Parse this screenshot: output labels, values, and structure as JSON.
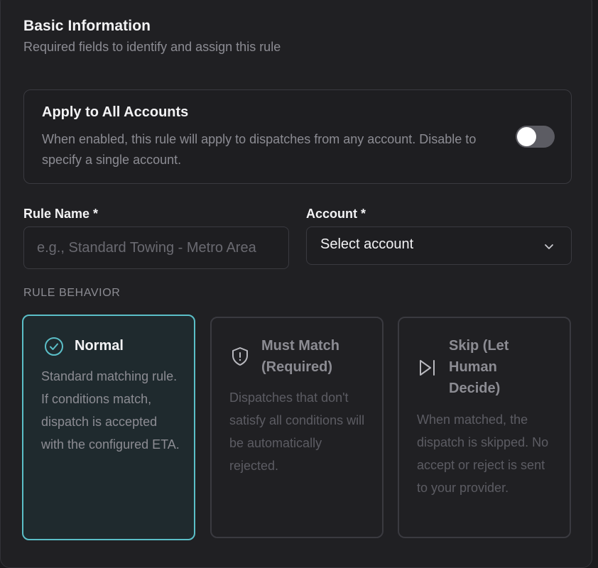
{
  "basic_info": {
    "title": "Basic Information",
    "subtitle": "Required fields to identify and assign this rule"
  },
  "apply_all": {
    "title": "Apply to All Accounts",
    "description": "When enabled, this rule will apply to dispatches from any account. Disable to specify a single account.",
    "enabled": false
  },
  "rule_name": {
    "label": "Rule Name *",
    "value": "",
    "placeholder": "e.g., Standard Towing - Metro Area"
  },
  "account": {
    "label": "Account *",
    "selected": "Select account"
  },
  "rule_behavior": {
    "heading": "RULE BEHAVIOR",
    "options": [
      {
        "title": "Normal",
        "description": "Standard matching rule. If conditions match, dispatch is accepted with the configured ETA.",
        "icon": "check-circle-icon",
        "selected": true
      },
      {
        "title": "Must Match (Required)",
        "description": "Dispatches that don't satisfy all conditions will be automatically rejected.",
        "icon": "shield-alert-icon",
        "selected": false
      },
      {
        "title": "Skip (Let Human Decide)",
        "description": "When matched, the dispatch is skipped. No accept or reject is sent to your provider.",
        "icon": "skip-forward-icon",
        "selected": false
      }
    ]
  },
  "colors": {
    "accent": "#5bbfc8",
    "background": "#202023",
    "border": "#3a3a40"
  }
}
